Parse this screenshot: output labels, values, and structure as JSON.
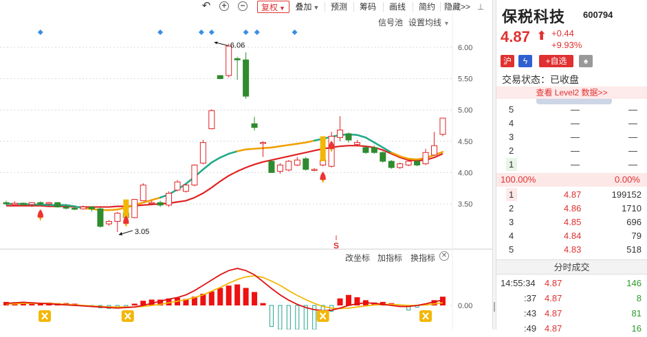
{
  "toolbar": {
    "buttons": [
      "复权",
      "叠加",
      "预测",
      "筹码",
      "画线",
      "简约",
      "隐藏>>"
    ],
    "undo_icon": "undo-icon",
    "zoom_in_icon": "zoom-in-icon",
    "zoom_out_icon": "zoom-out-icon",
    "dropdown_icon": "caret-down-icon"
  },
  "chart_links": {
    "signal": "信号池",
    "settings": "设置均线"
  },
  "indicator_links": {
    "coord": "改坐标",
    "add": "加指标",
    "switch": "换指标"
  },
  "annotations": {
    "high": "6.06",
    "low": "3.05",
    "sell": "S"
  },
  "chart_data": [
    {
      "type": "candlestick",
      "ylim": [
        2.95,
        6.35
      ],
      "yticks": [
        "6.00",
        "5.50",
        "5.00",
        "4.50",
        "4.00",
        "3.50"
      ],
      "candles": [
        [
          3.52,
          3.5,
          3.55,
          3.48
        ],
        [
          3.49,
          3.51,
          3.54,
          3.47
        ],
        [
          3.51,
          3.49,
          3.52,
          3.46
        ],
        [
          3.49,
          3.52,
          3.53,
          3.45
        ],
        [
          3.52,
          3.5,
          3.54,
          3.48
        ],
        [
          3.5,
          3.52,
          3.53,
          3.47
        ],
        [
          3.52,
          3.45,
          3.53,
          3.44
        ],
        [
          3.45,
          3.43,
          3.48,
          3.41
        ],
        [
          3.43,
          3.42,
          3.46,
          3.4
        ],
        [
          3.42,
          3.45,
          3.47,
          3.41
        ],
        [
          3.45,
          3.42,
          3.46,
          3.38
        ],
        [
          3.42,
          3.14,
          3.44,
          3.12
        ],
        [
          3.18,
          3.22,
          3.24,
          3.15
        ],
        [
          3.22,
          3.35,
          3.37,
          3.05
        ],
        [
          3.35,
          3.28,
          3.45,
          3.26
        ],
        [
          3.28,
          3.57,
          3.58,
          3.27
        ],
        [
          3.55,
          3.8,
          3.83,
          3.55
        ],
        [
          3.52,
          3.52,
          3.55,
          3.5
        ],
        [
          3.52,
          3.48,
          3.55,
          3.45
        ],
        [
          3.48,
          3.67,
          3.7,
          3.45
        ],
        [
          3.72,
          3.85,
          3.88,
          3.7
        ],
        [
          3.7,
          3.8,
          3.82,
          3.68
        ],
        [
          3.8,
          4.12,
          4.13,
          3.78
        ],
        [
          4.15,
          4.48,
          4.52,
          4.13
        ],
        [
          4.7,
          4.99,
          5.01,
          4.69
        ],
        [
          5.55,
          5.5,
          5.53,
          5.49
        ],
        [
          5.55,
          6.02,
          6.06,
          5.52
        ],
        [
          5.82,
          5.8,
          5.85,
          5.48
        ],
        [
          5.8,
          5.22,
          5.92,
          5.18
        ],
        [
          4.78,
          4.72,
          4.89,
          4.67
        ],
        [
          4.48,
          4.48,
          4.5,
          4.25
        ],
        [
          4.18,
          4.0,
          4.2,
          4.02
        ],
        [
          4.02,
          4.12,
          4.15,
          3.98
        ],
        [
          4.04,
          4.18,
          4.2,
          4.02
        ],
        [
          4.12,
          4.2,
          4.25,
          4.1
        ],
        [
          4.22,
          4.05,
          4.25,
          4.03
        ],
        [
          4.04,
          4.05,
          4.07,
          4.02
        ],
        [
          4.12,
          4.2,
          4.22,
          4.1
        ],
        [
          4.1,
          4.58,
          4.65,
          4.08
        ],
        [
          4.56,
          4.68,
          4.9,
          4.5
        ],
        [
          4.62,
          4.52,
          4.64,
          4.48
        ],
        [
          4.45,
          4.48,
          4.52,
          4.42
        ],
        [
          4.4,
          4.32,
          4.43,
          4.3
        ],
        [
          4.4,
          4.32,
          4.43,
          4.3
        ],
        [
          4.32,
          4.18,
          4.34,
          4.16
        ],
        [
          4.18,
          4.08,
          4.2,
          4.06
        ],
        [
          4.08,
          4.14,
          4.16,
          4.06
        ],
        [
          4.12,
          4.18,
          4.2,
          4.1
        ],
        [
          4.18,
          4.12,
          4.2,
          4.1
        ],
        [
          4.14,
          4.32,
          4.38,
          4.12
        ],
        [
          4.28,
          4.43,
          4.65,
          4.27
        ],
        [
          4.61,
          4.87,
          4.87,
          4.58
        ]
      ],
      "ma_red": [
        3.47,
        3.47,
        3.47,
        3.47,
        3.47,
        3.46,
        3.46,
        3.46,
        3.45,
        3.45,
        3.45,
        3.45,
        3.45,
        3.46,
        3.46,
        3.47,
        3.48,
        3.49,
        3.5,
        3.51,
        3.53,
        3.55,
        3.6,
        3.67,
        3.76,
        3.86,
        3.95,
        4.02,
        4.08,
        4.13,
        4.17,
        4.2,
        4.23,
        4.26,
        4.29,
        4.32,
        4.35,
        4.38,
        4.4,
        4.42,
        4.43,
        4.43,
        4.42,
        4.4,
        4.36,
        4.3,
        4.24,
        4.2,
        4.19,
        4.2,
        4.24,
        4.3
      ],
      "ma_cycle": [
        3.5,
        3.5,
        3.5,
        3.49,
        3.49,
        3.48,
        3.48,
        3.48,
        3.46,
        3.43,
        3.42,
        3.4,
        3.4,
        3.41,
        3.44,
        3.48,
        3.52,
        3.56,
        3.6,
        3.65,
        3.73,
        3.82,
        3.93,
        4.05,
        4.16,
        4.24,
        4.3,
        4.34,
        4.37,
        4.38,
        4.39,
        4.4,
        4.42,
        4.44,
        4.46,
        4.48,
        4.51,
        4.54,
        4.57,
        4.6,
        4.61,
        4.6,
        4.56,
        4.48,
        4.4,
        4.32,
        4.26,
        4.22,
        4.21,
        4.23,
        4.28,
        4.33
      ],
      "ma_cycle_colors": [
        "#22aa88",
        "#f0a000"
      ],
      "up_color": "#e02020",
      "down_color": "#2e8b2e",
      "ma_color": "#e02020"
    },
    {
      "type": "macd",
      "yticks": [
        "0.00"
      ],
      "histogram": [
        0.6,
        0.5,
        0.6,
        0.5,
        0.4,
        0.5,
        0.4,
        0.4,
        0.3,
        -0.1,
        -0.2,
        -0.4,
        -0.5,
        -0.4,
        -0.3,
        0.3,
        0.8,
        1.0,
        1.0,
        1.2,
        1.3,
        1.1,
        1.5,
        2.0,
        2.4,
        3.0,
        3.4,
        3.6,
        3.0,
        2.3,
        0.4,
        -3.6,
        -4.2,
        -5.6,
        -6.0,
        -5.2,
        -4.3,
        -2.0,
        -1.0,
        1.2,
        1.8,
        1.4,
        0.9,
        0.5,
        0.6,
        0.4,
        0.1,
        -0.8,
        -0.3,
        0.3,
        0.9,
        1.5
      ],
      "dif": [
        0.4,
        0.5,
        0.6,
        0.5,
        0.4,
        0.3,
        0.2,
        0.1,
        0.0,
        -0.1,
        -0.2,
        -0.3,
        -0.4,
        -0.5,
        -0.4,
        -0.3,
        0.0,
        0.4,
        0.8,
        1.2,
        1.5,
        2.0,
        2.8,
        3.8,
        4.8,
        5.8,
        6.6,
        7.0,
        6.6,
        5.8,
        4.5,
        3.2,
        2.0,
        1.0,
        0.2,
        -0.4,
        -0.8,
        -1.0,
        -0.9,
        -0.5,
        0.0,
        0.3,
        0.5,
        0.4,
        0.2,
        0.0,
        -0.2,
        -0.2,
        0.0,
        0.3,
        0.7,
        1.0
      ],
      "dea": [
        0.3,
        0.3,
        0.4,
        0.4,
        0.4,
        0.4,
        0.3,
        0.2,
        0.1,
        0.0,
        -0.1,
        -0.2,
        -0.3,
        -0.3,
        -0.3,
        -0.3,
        -0.2,
        0.0,
        0.2,
        0.5,
        0.8,
        1.1,
        1.5,
        2.0,
        2.7,
        3.4,
        4.2,
        4.9,
        5.4,
        5.6,
        5.3,
        4.6,
        3.8,
        2.8,
        1.9,
        1.1,
        0.4,
        -0.2,
        -0.5,
        -0.6,
        -0.5,
        -0.3,
        -0.1,
        0.1,
        0.2,
        0.2,
        0.1,
        0.0,
        0.0,
        0.1,
        0.3,
        0.5
      ]
    }
  ],
  "quote": {
    "name": "保税科技",
    "code": "600794",
    "price": "4.87",
    "arrow": "⬆",
    "change": "+0.44",
    "pct": "+9.93%",
    "tag_market": "沪",
    "tag_add": "+自选",
    "status_label": "交易状态：已收盘",
    "level2_link": "查看 Level2 数据>>",
    "ratio_left": "100.00%",
    "ratio_right": "0.00%",
    "sell_levels": [
      {
        "lvl": "5",
        "price": "—",
        "vol": "—"
      },
      {
        "lvl": "4",
        "price": "—",
        "vol": "—"
      },
      {
        "lvl": "3",
        "price": "—",
        "vol": "—"
      },
      {
        "lvl": "2",
        "price": "—",
        "vol": "—"
      },
      {
        "lvl": "1",
        "price": "—",
        "vol": "—"
      }
    ],
    "buy_levels": [
      {
        "lvl": "1",
        "price": "4.87",
        "vol": "199152"
      },
      {
        "lvl": "2",
        "price": "4.86",
        "vol": "1710"
      },
      {
        "lvl": "3",
        "price": "4.85",
        "vol": "696"
      },
      {
        "lvl": "4",
        "price": "4.84",
        "vol": "79"
      },
      {
        "lvl": "5",
        "price": "4.83",
        "vol": "518"
      }
    ],
    "trades_title": "分时成交",
    "trades": [
      {
        "time": "14:55:34",
        "price": "4.87",
        "vol": "146"
      },
      {
        "time": ":37",
        "price": "4.87",
        "vol": "8"
      },
      {
        "time": ":43",
        "price": "4.87",
        "vol": "81"
      },
      {
        "time": ":49",
        "price": "4.87",
        "vol": "16"
      }
    ],
    "colors": {
      "up": "#e03030",
      "down": "#2a9a2a"
    }
  }
}
